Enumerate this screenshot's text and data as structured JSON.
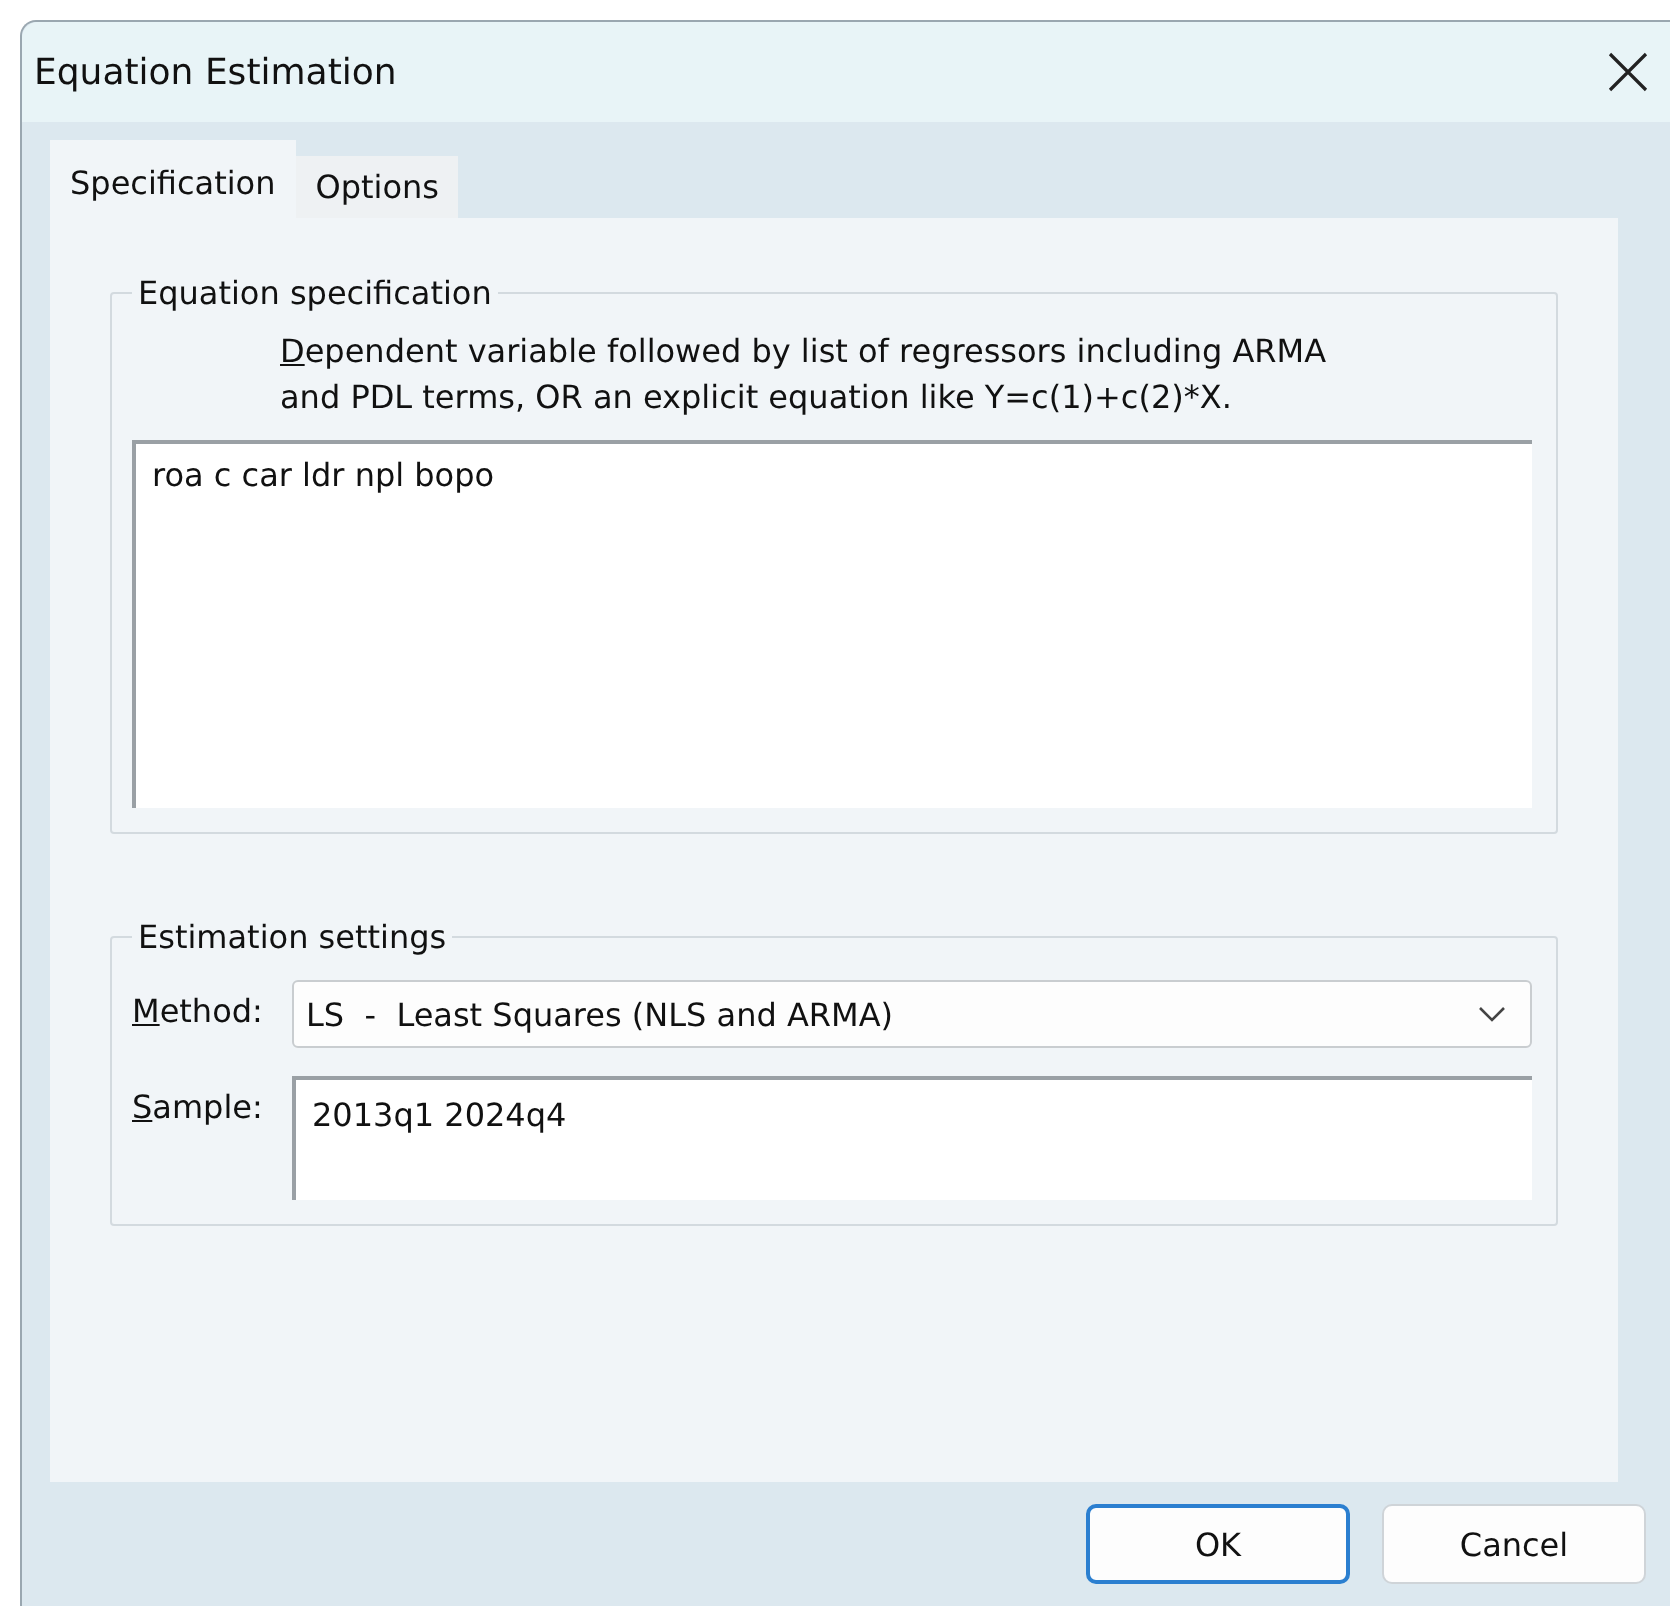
{
  "window": {
    "title": "Equation Estimation"
  },
  "tabs": [
    {
      "label": "Specification",
      "selected": true
    },
    {
      "label": "Options",
      "selected": false
    }
  ],
  "equation_specification": {
    "legend": "Equation specification",
    "hint_lines": [
      "Dependent variable followed by list of regressors including ARMA",
      "and PDL terms, OR an explicit equation like Y=c(1)+c(2)*X."
    ],
    "hint_mnemonic_first": true,
    "value": "roa c car ldr npl bopo"
  },
  "estimation_settings": {
    "legend": "Estimation settings",
    "method": {
      "label": "Method:",
      "mnemonic_first": true,
      "value": "LS  -  Least Squares (NLS and ARMA)"
    },
    "sample": {
      "label": "Sample:",
      "mnemonic_first": true,
      "value": "2013q1 2024q4"
    }
  },
  "buttons": [
    {
      "label": "OK",
      "default": true
    },
    {
      "label": "Cancel",
      "default": false
    }
  ]
}
